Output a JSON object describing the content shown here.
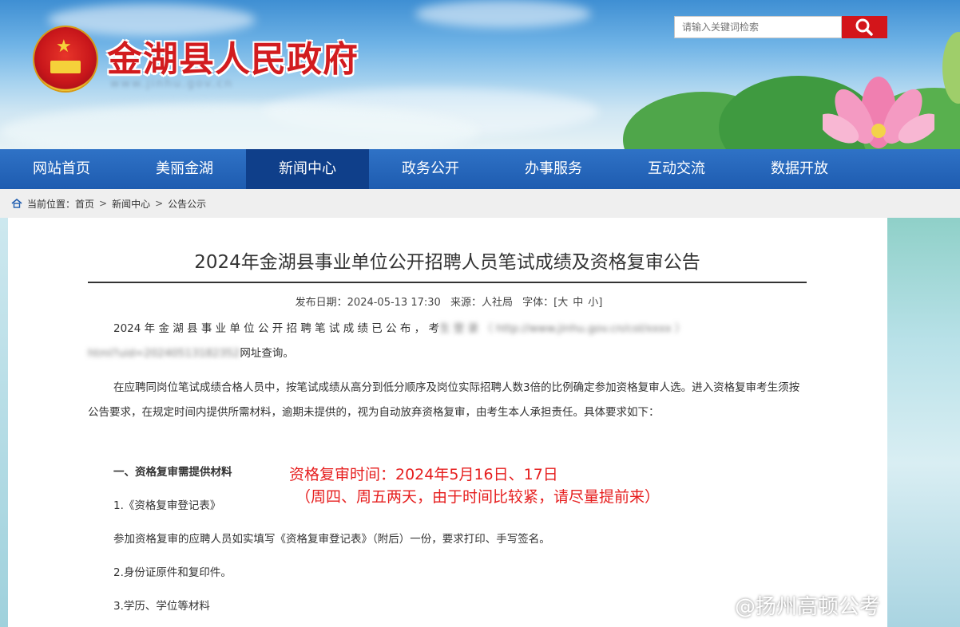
{
  "header": {
    "site_name": "金湖县人民政府",
    "site_domain": "www.jinhu.gov.cn",
    "search_placeholder": "请输入关键词检索"
  },
  "nav": {
    "items": [
      "网站首页",
      "美丽金湖",
      "新闻中心",
      "政务公开",
      "办事服务",
      "互动交流",
      "数据开放"
    ],
    "active": "新闻中心"
  },
  "breadcrumb": {
    "label": "当前位置：",
    "items": [
      "首页",
      "新闻中心",
      "公告公示"
    ],
    "separator": ">"
  },
  "article": {
    "title": "2024年金湖县事业单位公开招聘人员笔试成绩及资格复审公告",
    "meta": {
      "date_label": "发布日期：",
      "date": "2024-05-13 17:30",
      "source_label": "来源：",
      "source": "人社局",
      "font_label": "字体：",
      "font_open": "[",
      "font_large": "大",
      "font_medium": "中",
      "font_small": "小",
      "font_close": "]"
    },
    "p1_visible": "2024 年 金 湖 县 事 业 单 位 公 开 招 聘 笔 试 成 绩 已 公 布 ， 考",
    "p1_blurred": "生 登 录 （ http://www.jinhu.gov.cn/col/xxxx ）",
    "p1_line2_blurred": "html?uid=20240513182352",
    "p1_line2_visible": "网址查询。",
    "p2": "在应聘同岗位笔试成绩合格人员中，按笔试成绩从高分到低分顺序及岗位实际招聘人数3倍的比例确定参加资格复审人选。进入资格复审考生须按公告要求，在规定时间内提供所需材料，逾期未提供的，视为自动放弃资格复审，由考生本人承担责任。具体要求如下：",
    "section_heading": "一、资格复审需提供材料",
    "item1": "1.《资格复审登记表》",
    "item1_desc": "参加资格复审的应聘人员如实填写《资格复审登记表》（附后）一份，要求打印、手写签名。",
    "item2": "2.身份证原件和复印件。",
    "item3": "3.学历、学位等材料"
  },
  "annotation": {
    "line1": "资格复审时间：2024年5月16日、17日",
    "line2": "（周四、周五两天，由于时间比较紧，请尽量提前来）",
    "color": "#e61e1e"
  },
  "watermark": "@扬州高顿公考",
  "colors": {
    "nav_bg": "#1e5cb0",
    "nav_active": "#0f3f8a",
    "brand_red": "#d21c1f",
    "search_button": "#d3151a"
  }
}
